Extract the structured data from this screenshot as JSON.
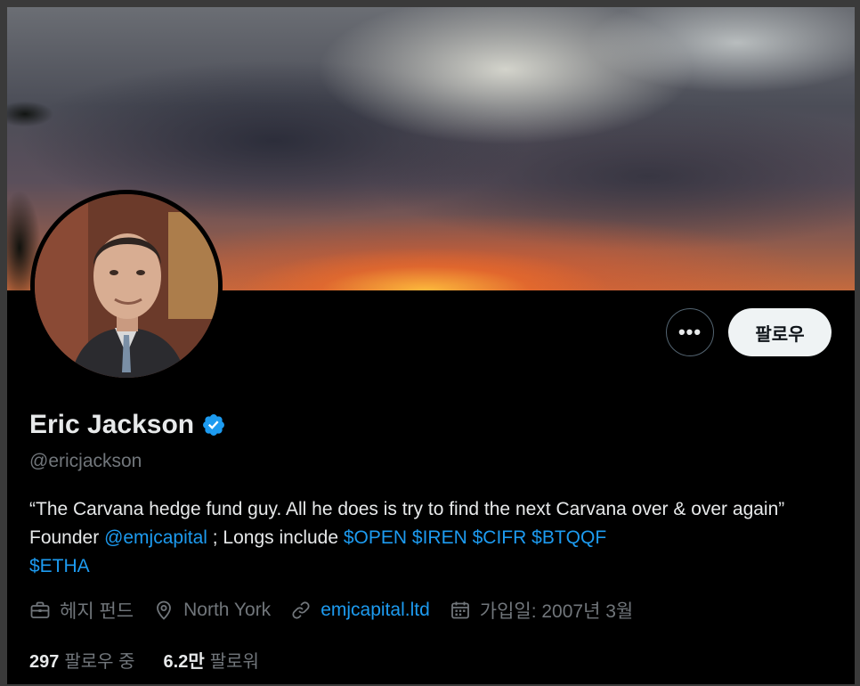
{
  "profile": {
    "display_name": "Eric Jackson",
    "handle": "@ericjackson",
    "bio": {
      "part1": "“The Carvana hedge fund guy. All he does is try to find the next Carvana over & over again” Founder ",
      "mention": "@emjcapital",
      "part2": " ; Longs include ",
      "cashtags": [
        "$OPEN",
        "$IREN",
        "$CIFR",
        "$BTQQF",
        "$ETHA"
      ]
    },
    "meta": {
      "category": "헤지 펀드",
      "location": "North York",
      "website": "emjcapital.ltd",
      "joined": "가입일: 2007년 3월"
    },
    "stats": {
      "following_count": "297",
      "following_label": "팔로우 중",
      "followers_count": "6.2만",
      "followers_label": "팔로워"
    }
  },
  "actions": {
    "more_label": "•••",
    "follow_label": "팔로우"
  },
  "colors": {
    "accent": "#1d9bf0",
    "background": "#000000",
    "secondary_text": "#71767b"
  },
  "icons": {
    "verified": "verified-badge-icon",
    "category": "briefcase-icon",
    "location": "location-pin-icon",
    "website": "link-icon",
    "joined": "calendar-icon"
  }
}
